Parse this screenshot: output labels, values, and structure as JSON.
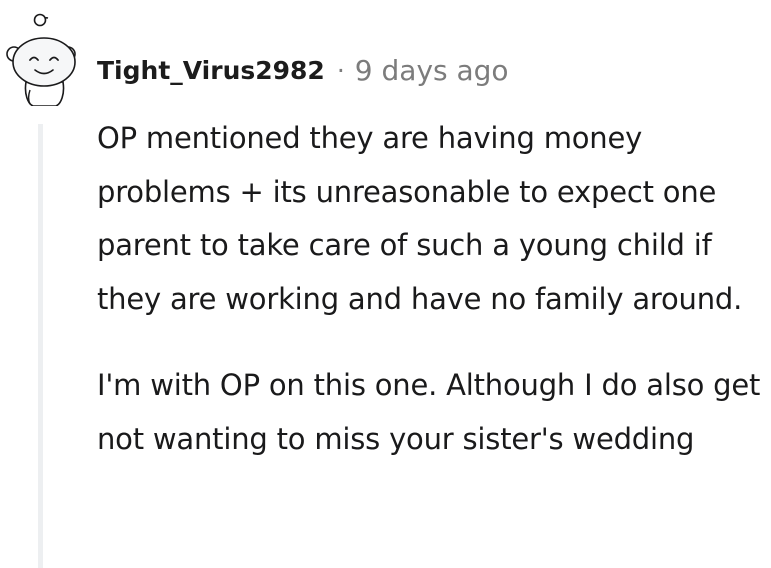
{
  "comment": {
    "username": "Tight_Virus2982",
    "separator": "·",
    "timestamp": "9 days ago",
    "paragraphs": [
      "OP mentioned they are having money problems + its unreasonable to expect one parent to take care of such a young child if they are working and have no family around.",
      "I'm with OP on this one. Although I do also get not wanting to miss your sister's wedding"
    ],
    "avatar_icon": "snoo-avatar-icon"
  },
  "colors": {
    "username": "#1c1c1c",
    "meta": "#7c7c7c",
    "text": "#1a1a1b",
    "thread_line": "#edeff1",
    "avatar_bg": "#f6f7f8",
    "avatar_stroke": "#1a1a1b"
  }
}
